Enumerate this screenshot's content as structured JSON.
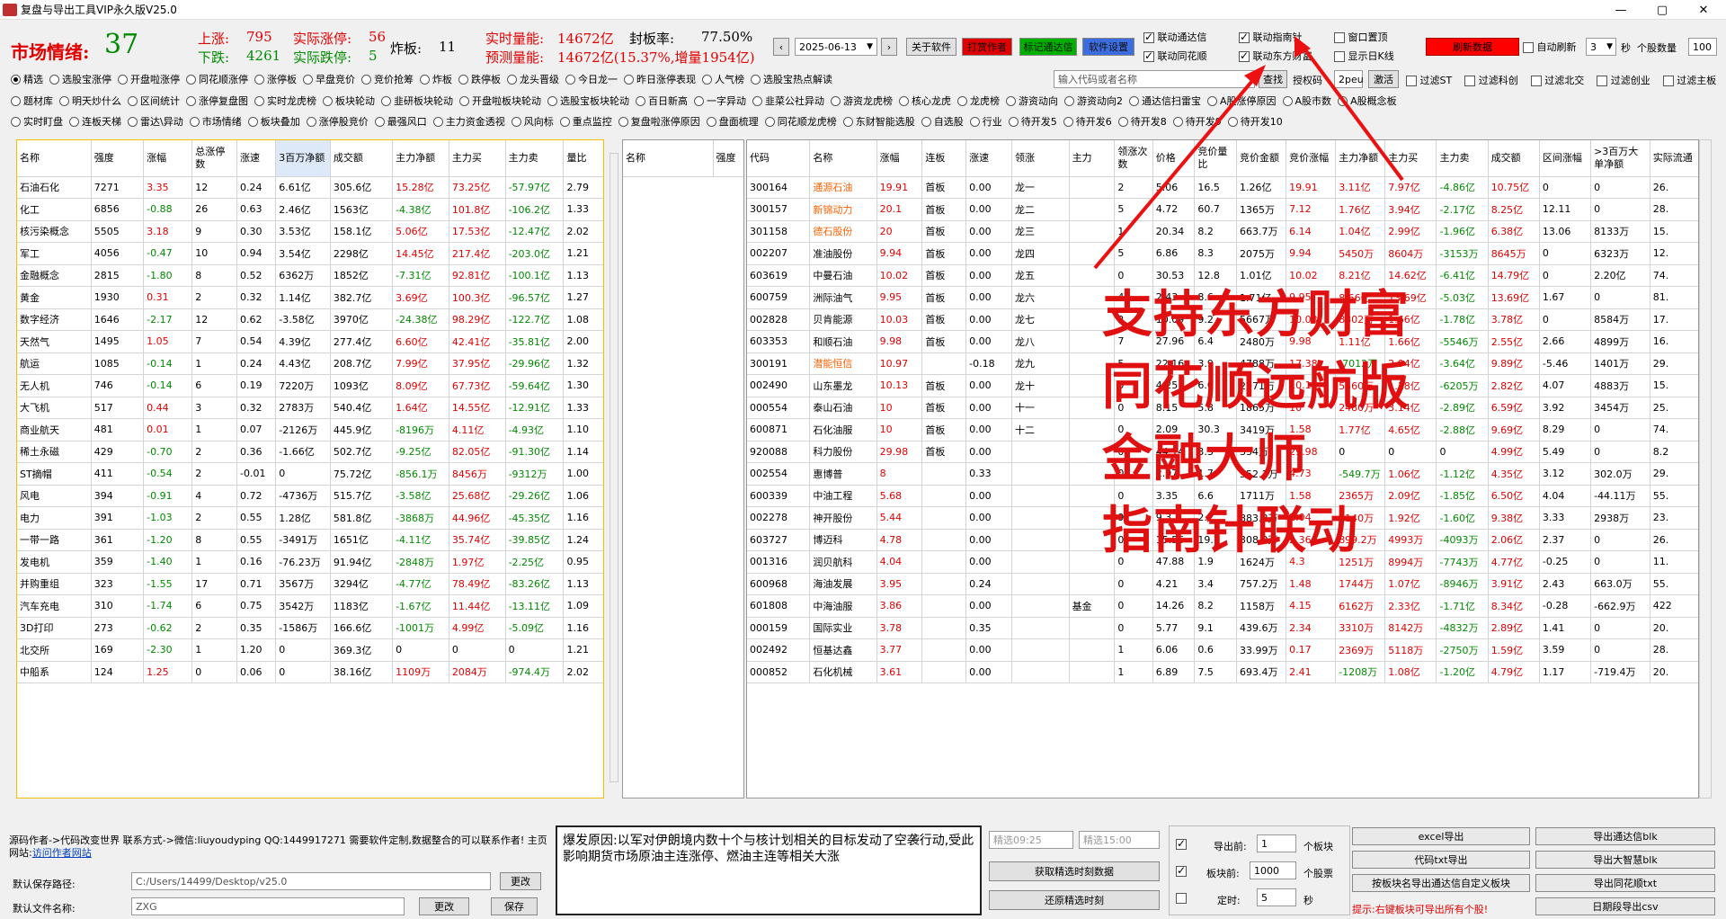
{
  "window": {
    "title": "复盘与导出工具VIP永久版V25.0"
  },
  "header": {
    "mood_label": "市场情绪:",
    "mood_value": "37",
    "up_label": "上涨:",
    "up_value": "795",
    "up_limit_label": "实际涨停:",
    "up_limit_value": "56",
    "down_label": "下跌:",
    "down_value": "4261",
    "down_limit_label": "实际跌停:",
    "down_limit_value": "5",
    "blast_label": "炸板:",
    "blast_value": "11",
    "vol_label": "实时量能:",
    "vol_value": "14672亿",
    "seal_label": "封板率:",
    "seal_value": "77.50%",
    "pred_label": "预测量能:",
    "pred_value": "14672亿(15.37%,增量1954亿)",
    "date": "2025-06-13",
    "buttons": {
      "about": "关于软件",
      "reward": "打赏作者",
      "mark": "标记通达信",
      "settings": "软件设置",
      "refresh": "刷新数据",
      "search": "查找",
      "union": "激活"
    },
    "checks": {
      "link_tdx": "联动通达信",
      "link_znz": "联动指南针",
      "link_ths": "联动同花顺",
      "link_dfcf": "联动东方财富",
      "top": "窗口置顶",
      "kline": "显示日K线",
      "auto_refresh": "自动刷新"
    },
    "refresh_seconds": "3",
    "sec_label": "秒",
    "stock_count_label": "个股数量",
    "stock_count": "100",
    "search_placeholder": "输入代码或者名称",
    "auth_label": "授权码",
    "auth_code": "2peu",
    "filters": [
      "过滤ST",
      "过滤科创",
      "过滤北交",
      "过滤创业",
      "过滤主板"
    ]
  },
  "options": {
    "row1": [
      "精选",
      "选股宝涨停",
      "开盘啦涨停",
      "同花顺涨停",
      "涨停板",
      "早盘竞价",
      "竞价抢筹",
      "炸板",
      "跌停板",
      "龙头晋级",
      "今日龙一",
      "昨日涨停表现",
      "人气榜",
      "选股宝热点解读"
    ],
    "row2": [
      "题材库",
      "明天炒什么",
      "区间统计",
      "涨停复盘图",
      "实时龙虎榜",
      "板块轮动",
      "韭研板块轮动",
      "开盘啦板块轮动",
      "选股宝板块轮动",
      "百日新高",
      "一字异动",
      "韭菜公社异动",
      "游资龙虎榜",
      "核心龙虎",
      "龙虎榜",
      "游资动向",
      "游资动向2",
      "通达信扫雷宝",
      "A股涨停原因",
      "A股市数",
      "A股概念板"
    ],
    "row3": [
      "实时盯盘",
      "连板天梯",
      "雷达\\异动",
      "市场情绪",
      "板块叠加",
      "涨停股竞价",
      "最强风口",
      "主力资金透视",
      "风向标",
      "重点监控",
      "复盘啦涨停原因",
      "盘面梳理",
      "同花顺龙虎榜",
      "东财智能选股",
      "自选股",
      "行业",
      "待开发5",
      "待开发6",
      "待开发8",
      "待开发9",
      "待开发10"
    ]
  },
  "left_table": {
    "headers": [
      "名称",
      "强度",
      "涨幅",
      "总涨停数",
      "涨速",
      "3百万净额",
      "成交额",
      "主力净额",
      "主力买",
      "主力卖",
      "量比"
    ],
    "rows": [
      [
        "石油石化",
        "7271",
        "3.35",
        "12",
        "0.24",
        "6.61亿",
        "305.6亿",
        "15.28亿",
        "73.25亿",
        "-57.97亿",
        "2.79"
      ],
      [
        "化工",
        "6856",
        "-0.88",
        "26",
        "0.63",
        "2.46亿",
        "1563亿",
        "-4.38亿",
        "101.8亿",
        "-106.2亿",
        "1.33"
      ],
      [
        "核污染概念",
        "5505",
        "3.18",
        "9",
        "0.30",
        "3.53亿",
        "158.1亿",
        "5.06亿",
        "17.53亿",
        "-12.47亿",
        "2.02"
      ],
      [
        "军工",
        "4056",
        "-0.47",
        "10",
        "0.94",
        "3.54亿",
        "2298亿",
        "14.45亿",
        "217.4亿",
        "-203.0亿",
        "1.21"
      ],
      [
        "金融概念",
        "2815",
        "-1.80",
        "8",
        "0.52",
        "6362万",
        "1852亿",
        "-7.31亿",
        "92.81亿",
        "-100.1亿",
        "1.13"
      ],
      [
        "黄金",
        "1930",
        "0.31",
        "2",
        "0.32",
        "1.14亿",
        "382.7亿",
        "3.69亿",
        "100.3亿",
        "-96.57亿",
        "1.27"
      ],
      [
        "数字经济",
        "1646",
        "-2.17",
        "12",
        "0.62",
        "-3.58亿",
        "3970亿",
        "-24.38亿",
        "98.29亿",
        "-122.7亿",
        "1.08"
      ],
      [
        "天然气",
        "1495",
        "1.05",
        "7",
        "0.54",
        "4.39亿",
        "277.4亿",
        "6.60亿",
        "42.41亿",
        "-35.81亿",
        "2.00"
      ],
      [
        "航运",
        "1085",
        "-0.14",
        "1",
        "0.24",
        "4.43亿",
        "208.7亿",
        "7.99亿",
        "37.95亿",
        "-29.96亿",
        "1.32"
      ],
      [
        "无人机",
        "746",
        "-0.14",
        "6",
        "0.19",
        "7220万",
        "1093亿",
        "8.09亿",
        "67.73亿",
        "-59.64亿",
        "1.30"
      ],
      [
        "大飞机",
        "517",
        "0.44",
        "3",
        "0.32",
        "2783万",
        "540.4亿",
        "1.64亿",
        "14.55亿",
        "-12.91亿",
        "1.33"
      ],
      [
        "商业航天",
        "481",
        "0.01",
        "1",
        "0.07",
        "-2126万",
        "445.9亿",
        "-8196万",
        "4.11亿",
        "-4.93亿",
        "1.10"
      ],
      [
        "稀土永磁",
        "429",
        "-0.70",
        "2",
        "0.36",
        "-1.66亿",
        "502.7亿",
        "-9.25亿",
        "82.05亿",
        "-91.30亿",
        "1.14"
      ],
      [
        "ST摘帽",
        "411",
        "-0.54",
        "2",
        "-0.01",
        "0",
        "75.72亿",
        "-856.1万",
        "8456万",
        "-9312万",
        "1.00"
      ],
      [
        "风电",
        "394",
        "-0.91",
        "4",
        "0.72",
        "-4736万",
        "515.7亿",
        "-3.58亿",
        "25.68亿",
        "-29.26亿",
        "1.06"
      ],
      [
        "电力",
        "391",
        "-1.03",
        "2",
        "0.55",
        "1.28亿",
        "581.8亿",
        "-3868万",
        "44.96亿",
        "-45.35亿",
        "1.16"
      ],
      [
        "一带一路",
        "361",
        "-1.20",
        "8",
        "0.55",
        "-3491万",
        "1651亿",
        "-4.11亿",
        "35.74亿",
        "-39.85亿",
        "1.24"
      ],
      [
        "发电机",
        "359",
        "-1.40",
        "1",
        "0.16",
        "-76.23万",
        "91.94亿",
        "-2848万",
        "1.97亿",
        "-2.25亿",
        "0.95"
      ],
      [
        "并购重组",
        "323",
        "-1.55",
        "17",
        "0.71",
        "3567万",
        "3294亿",
        "-4.77亿",
        "78.49亿",
        "-83.26亿",
        "1.13"
      ],
      [
        "汽车充电",
        "310",
        "-1.74",
        "6",
        "0.75",
        "3542万",
        "1183亿",
        "-1.67亿",
        "11.44亿",
        "-13.11亿",
        "1.09"
      ],
      [
        "3D打印",
        "273",
        "-0.62",
        "2",
        "0.35",
        "-1586万",
        "166.6亿",
        "-1001万",
        "4.99亿",
        "-5.09亿",
        "1.16"
      ],
      [
        "北交所",
        "169",
        "-2.30",
        "1",
        "1.20",
        "0",
        "369.3亿",
        "0",
        "0",
        "0",
        "1.21"
      ],
      [
        "中船系",
        "124",
        "1.25",
        "0",
        "0.06",
        "0",
        "38.16亿",
        "1109万",
        "2084万",
        "-974.4万",
        "2.02"
      ]
    ]
  },
  "mid_table": {
    "headers": [
      "名称",
      "强度"
    ]
  },
  "right_table": {
    "headers": [
      "代码",
      "名称",
      "涨幅",
      "连板",
      "涨速",
      "领涨",
      "主力",
      "领涨次数",
      "价格",
      "竞价量比",
      "竞价金额",
      "竞价涨幅",
      "主力净额",
      "主力买",
      "主力卖",
      "成交额",
      "区间涨幅",
      ">3百万大单净额",
      "实际流通"
    ],
    "rows": [
      [
        "300164",
        "通源石油",
        "19.91",
        "首板",
        "0.00",
        "龙一",
        "",
        "2",
        "5.06",
        "16.5",
        "1.26亿",
        "19.91",
        "3.11亿",
        "7.97亿",
        "-4.86亿",
        "10.75亿",
        "0",
        "0",
        "26."
      ],
      [
        "300157",
        "新锦动力",
        "20.1",
        "首板",
        "0.00",
        "龙二",
        "",
        "5",
        "4.72",
        "60.7",
        "1365万",
        "7.12",
        "1.76亿",
        "3.94亿",
        "-2.17亿",
        "8.25亿",
        "12.11",
        "0",
        "28."
      ],
      [
        "301158",
        "德石股份",
        "20",
        "首板",
        "0.00",
        "龙三",
        "",
        "1",
        "20.34",
        "8.2",
        "663.7万",
        "6.14",
        "1.04亿",
        "2.99亿",
        "-1.96亿",
        "6.38亿",
        "13.06",
        "8133万",
        "15."
      ],
      [
        "002207",
        "准油股份",
        "9.94",
        "首板",
        "0.00",
        "龙四",
        "",
        "5",
        "6.86",
        "8.3",
        "2075万",
        "9.94",
        "5450万",
        "8604万",
        "-3153万",
        "8645万",
        "0",
        "6323万",
        "12."
      ],
      [
        "603619",
        "中曼石油",
        "10.02",
        "首板",
        "0.00",
        "龙五",
        "",
        "0",
        "30.53",
        "12.8",
        "1.01亿",
        "10.02",
        "8.21亿",
        "14.62亿",
        "-6.41亿",
        "14.79亿",
        "0",
        "2.20亿",
        "74."
      ],
      [
        "600759",
        "洲际油气",
        "9.95",
        "首板",
        "0.00",
        "龙六",
        "",
        "4",
        "2.43",
        "8.6",
        "1.71亿",
        "9.95",
        "8.66亿",
        "13.69亿",
        "-5.03亿",
        "13.69亿",
        "1.67",
        "0",
        "81."
      ],
      [
        "002828",
        "贝肯能源",
        "10.03",
        "首板",
        "0.00",
        "龙七",
        "",
        "2",
        "10.09",
        "9.2",
        "5667万",
        "10.03",
        "8802万",
        "1.66亿",
        "-1.78亿",
        "3.78亿",
        "0",
        "8584万",
        "17."
      ],
      [
        "603353",
        "和顺石油",
        "9.98",
        "首板",
        "0.00",
        "龙八",
        "",
        "7",
        "27.96",
        "6.4",
        "2480万",
        "9.98",
        "1.11亿",
        "1.66亿",
        "-5546万",
        "2.55亿",
        "2.66",
        "4899万",
        "16."
      ],
      [
        "300191",
        "潜能恒信",
        "10.97",
        "",
        "-0.18",
        "龙九",
        "",
        "5",
        "22.16",
        "3.9",
        "4788万",
        "17.38",
        "-7012万",
        "2.94亿",
        "-3.64亿",
        "9.89亿",
        "-5.46",
        "1401万",
        "29."
      ],
      [
        "002490",
        "山东墨龙",
        "10.13",
        "首板",
        "0.00",
        "龙十",
        "",
        "0",
        "4.25",
        "6.0",
        "2071万",
        "10.13",
        "5560万",
        "1.18亿",
        "-6205万",
        "2.82亿",
        "4.07",
        "4883万",
        "15."
      ],
      [
        "000554",
        "泰山石油",
        "10",
        "首板",
        "0.00",
        "十一",
        "",
        "0",
        "8.15",
        "5.8",
        "1865万",
        "10",
        "2480万",
        "3.14亿",
        "-2.89亿",
        "6.59亿",
        "3.92",
        "3454万",
        "25."
      ],
      [
        "600871",
        "石化油服",
        "10",
        "首板",
        "0.00",
        "十二",
        "",
        "0",
        "2.09",
        "30.3",
        "3419万",
        "1.58",
        "1.77亿",
        "4.65亿",
        "-2.88亿",
        "9.69亿",
        "8.29",
        "0",
        "74."
      ],
      [
        "920088",
        "科力股份",
        "29.98",
        "首板",
        "0.00",
        "",
        "",
        "0",
        "44.14",
        "3.3",
        "334万",
        "29.98",
        "0",
        "0",
        "0",
        "4.99亿",
        "5.49",
        "0",
        "8.2"
      ],
      [
        "002554",
        "惠博普",
        "8",
        "",
        "0.33",
        "",
        "",
        "0",
        "2.97",
        "1.7",
        "552.1万",
        "4.73",
        "-549.7万",
        "1.06亿",
        "-1.12亿",
        "4.35亿",
        "3.12",
        "302.0万",
        "29."
      ],
      [
        "600339",
        "中油工程",
        "5.68",
        "",
        "0.00",
        "",
        "",
        "0",
        "3.35",
        "6.6",
        "1711万",
        "1.58",
        "2365万",
        "2.09亿",
        "-1.85亿",
        "6.50亿",
        "4.04",
        "-44.11万",
        "55."
      ],
      [
        "002278",
        "神开股份",
        "5.44",
        "",
        "0.00",
        "",
        "",
        "9",
        "9.3",
        "2.7",
        "883.8万",
        "2.04",
        "3140万",
        "1.92亿",
        "-1.60亿",
        "9.38亿",
        "3.33",
        "2938万",
        "23."
      ],
      [
        "603727",
        "博迈科",
        "4.78",
        "",
        "0.00",
        "",
        "",
        "0",
        "15.56",
        "19.7",
        "308.9万",
        "2.36",
        "899.2万",
        "4993万",
        "-4093万",
        "2.06亿",
        "2.37",
        "0",
        "26."
      ],
      [
        "001316",
        "润贝航科",
        "4.04",
        "",
        "0.00",
        "",
        "",
        "0",
        "47.88",
        "1.9",
        "1624万",
        "4.3",
        "1251万",
        "8994万",
        "-7743万",
        "4.77亿",
        "-0.25",
        "0",
        "11."
      ],
      [
        "600968",
        "海油发展",
        "3.95",
        "",
        "0.24",
        "",
        "",
        "0",
        "4.21",
        "3.4",
        "757.2万",
        "1.48",
        "1744万",
        "1.07亿",
        "-8946万",
        "3.91亿",
        "2.43",
        "663.0万",
        "55."
      ],
      [
        "601808",
        "中海油服",
        "3.86",
        "",
        "0.00",
        "",
        "基金",
        "0",
        "14.26",
        "8.2",
        "1158万",
        "4.15",
        "6162万",
        "2.33亿",
        "-1.71亿",
        "8.34亿",
        "-0.28",
        "-662.9万",
        "422"
      ],
      [
        "000159",
        "国际实业",
        "3.78",
        "",
        "0.35",
        "",
        "",
        "0",
        "5.77",
        "9.1",
        "439.6万",
        "2.34",
        "3310万",
        "8142万",
        "-4832万",
        "2.89亿",
        "1.41",
        "0",
        "20."
      ],
      [
        "002492",
        "恒基达鑫",
        "3.77",
        "",
        "0.00",
        "",
        "",
        "1",
        "6.06",
        "0.6",
        "33.99万",
        "0.17",
        "2369万",
        "5118万",
        "-2750万",
        "1.59亿",
        "3.59",
        "0",
        "28."
      ],
      [
        "000852",
        "石化机械",
        "3.61",
        "",
        "0.00",
        "",
        "",
        "1",
        "6.89",
        "7.5",
        "693.4万",
        "2.41",
        "-1208万",
        "1.08亿",
        "-1.20亿",
        "4.79亿",
        "1.17",
        "-719.4万",
        "20."
      ]
    ]
  },
  "overlay": [
    "支持东方财富",
    "同花顺远航版",
    "金融大师",
    "指南针联动"
  ],
  "bottom": {
    "author": "源码作者->代码改变世界 联系方式->微信:liuyoudyping QQ:1449917271 需要软件定制,数据整合的可以联系作者! 主页网站:",
    "author_link": "访问作者网站",
    "save_path_label": "默认保存路径:",
    "save_path": "C:/Users/14499/Desktop/v25.0",
    "change": "更改",
    "file_name_label": "默认文件名称:",
    "file_name": "ZXG",
    "save": "保存",
    "reason": "爆发原因:以军对伊朗境内数十个与核计划相关的目标发动了空袭行动,受此影响期货市场原油主连涨停、燃油主连等相关大涨",
    "time_start_ph": "精选09:25",
    "time_end_ph": "精选15:00",
    "get_time_btn": "获取精选时刻数据",
    "restore_btn": "还原精选时刻",
    "export_top_label": "导出前:",
    "export_top_value": "1",
    "export_top_unit": "个板块",
    "board_top_label": "板块前:",
    "board_top_value": "1000",
    "board_top_unit": "个股票",
    "timer_label": "定时:",
    "timer_value": "5",
    "timer_unit": "秒",
    "btns": [
      "excel导出",
      "导出通达信blk",
      "代码txt导出",
      "导出大智慧blk",
      "按板块名导出通达信自定义板块",
      "导出同花顺txt"
    ],
    "hint": "提示:右键板块可导出所有个股!",
    "date_export": "日期段导出csv"
  }
}
